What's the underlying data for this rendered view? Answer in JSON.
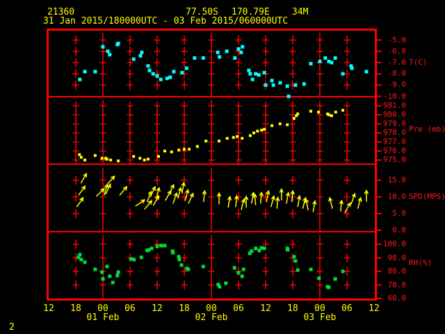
{
  "header": {
    "station_id": "21360",
    "latitude": "77.50S",
    "longitude": "170.79E",
    "elevation": "34M",
    "time_range": "31 Jan 2015/180000UTC - 03 Feb 2015/060000UTC"
  },
  "footer": {
    "page_label": "2"
  },
  "colors": {
    "background": "#000000",
    "grid": "#ff0000",
    "axis_text": "#ff1a1a",
    "header_text": "#ffff00",
    "temperature": "#00ffff",
    "pressure": "#ffff00",
    "wind": "#ffff00",
    "humidity": "#00dd3c"
  },
  "x_axis": {
    "hour_labels": [
      "12",
      "18",
      "00",
      "06",
      "12",
      "18",
      "00",
      "06",
      "12",
      "18",
      "00",
      "06",
      "12"
    ],
    "tick_interval_hours": 6,
    "hours_span": 72,
    "midnight_hours": [
      12,
      36,
      60
    ],
    "date_labels": [
      {
        "label": "01 Feb",
        "hour": 12
      },
      {
        "label": "02 Feb",
        "hour": 36
      },
      {
        "label": "03 Feb",
        "hour": 60
      }
    ]
  },
  "chart_data": [
    {
      "type": "scatter",
      "name": "temperature",
      "ylabel": "T(C)",
      "ylabel_at_value": -7,
      "yticks": [
        -5,
        -6,
        -7,
        -8,
        -9,
        -10
      ],
      "ytick_labels": [
        "-5.0",
        "-6.0",
        "-7.0",
        "-8.0",
        "-9.0",
        "-10.0"
      ],
      "x_unit": "hours since first axis tick (12UTC 31 Jan 2015)",
      "points": [
        [
          6.9,
          -8.5
        ],
        [
          8.0,
          -7.8
        ],
        [
          10.3,
          -7.8
        ],
        [
          12.0,
          -5.6
        ],
        [
          13.1,
          -6.0
        ],
        [
          13.5,
          -6.3
        ],
        [
          15.2,
          -5.4
        ],
        [
          15.4,
          -5.3
        ],
        [
          18.8,
          -6.7
        ],
        [
          20.3,
          -6.4
        ],
        [
          20.6,
          -6.1
        ],
        [
          22.0,
          -7.3
        ],
        [
          22.3,
          -7.7
        ],
        [
          23.1,
          -8.0
        ],
        [
          24.0,
          -8.2
        ],
        [
          24.8,
          -8.5
        ],
        [
          26.2,
          -8.4
        ],
        [
          26.9,
          -8.3
        ],
        [
          27.7,
          -7.8
        ],
        [
          29.5,
          -7.9
        ],
        [
          30.5,
          -7.5
        ],
        [
          32.3,
          -6.6
        ],
        [
          34.2,
          -6.6
        ],
        [
          37.4,
          -6.1
        ],
        [
          37.8,
          -6.5
        ],
        [
          39.4,
          -6.0
        ],
        [
          41.2,
          -6.6
        ],
        [
          42.0,
          -5.8
        ],
        [
          42.6,
          -6.1
        ],
        [
          42.9,
          -5.6
        ],
        [
          44.3,
          -7.7
        ],
        [
          44.6,
          -8.0
        ],
        [
          45.1,
          -8.5
        ],
        [
          45.8,
          -8.0
        ],
        [
          46.5,
          -8.1
        ],
        [
          47.7,
          -7.9
        ],
        [
          48.0,
          -9.0
        ],
        [
          49.4,
          -8.6
        ],
        [
          49.7,
          -9.0
        ],
        [
          51.2,
          -8.8
        ],
        [
          52.8,
          -9.1
        ],
        [
          53.1,
          -10.0
        ],
        [
          54.6,
          -9.0
        ],
        [
          56.5,
          -8.9
        ],
        [
          58.0,
          -7.1
        ],
        [
          60.0,
          -6.9
        ],
        [
          61.2,
          -6.6
        ],
        [
          62.0,
          -6.9
        ],
        [
          62.6,
          -7.0
        ],
        [
          63.4,
          -6.6
        ],
        [
          65.1,
          -8.0
        ],
        [
          66.9,
          -7.3
        ],
        [
          67.1,
          -7.5
        ],
        [
          70.3,
          -7.8
        ]
      ]
    },
    {
      "type": "scatter",
      "name": "pressure",
      "ylabel": "Pre (mb)",
      "ylabel_at_value": 978.4,
      "yticks": [
        981,
        980,
        979,
        978,
        977,
        976,
        975
      ],
      "ytick_labels": [
        "981.0",
        "980.0",
        "979.0",
        "978.0",
        "977.0",
        "976.0",
        "975.0"
      ],
      "x_unit": "hours since first axis tick (12UTC 31 Jan 2015)",
      "points": [
        [
          6.8,
          975.6
        ],
        [
          7.2,
          975.3
        ],
        [
          8.0,
          975.0
        ],
        [
          10.3,
          975.5
        ],
        [
          11.8,
          975.2
        ],
        [
          12.6,
          975.2
        ],
        [
          12.9,
          975.1
        ],
        [
          13.7,
          975.0
        ],
        [
          15.4,
          974.9
        ],
        [
          18.8,
          975.4
        ],
        [
          20.2,
          975.2
        ],
        [
          21.2,
          975.0
        ],
        [
          22.0,
          975.1
        ],
        [
          24.3,
          975.4
        ],
        [
          25.7,
          976.0
        ],
        [
          27.2,
          975.9
        ],
        [
          28.8,
          976.1
        ],
        [
          30.0,
          976.2
        ],
        [
          31.1,
          976.2
        ],
        [
          32.9,
          976.5
        ],
        [
          34.8,
          977.1
        ],
        [
          37.7,
          977.1
        ],
        [
          39.5,
          977.4
        ],
        [
          40.9,
          977.5
        ],
        [
          41.7,
          977.6
        ],
        [
          42.8,
          977.4
        ],
        [
          44.6,
          977.7
        ],
        [
          45.4,
          978.0
        ],
        [
          46.2,
          978.2
        ],
        [
          47.1,
          978.3
        ],
        [
          47.7,
          978.4
        ],
        [
          49.4,
          978.8
        ],
        [
          51.2,
          979.0
        ],
        [
          52.8,
          978.9
        ],
        [
          54.3,
          979.6
        ],
        [
          54.8,
          979.9
        ],
        [
          55.1,
          980.1
        ],
        [
          58.0,
          980.4
        ],
        [
          59.7,
          980.3
        ],
        [
          61.7,
          980.1
        ],
        [
          62.0,
          980.0
        ],
        [
          62.6,
          979.9
        ],
        [
          63.5,
          980.3
        ],
        [
          65.1,
          980.5
        ]
      ]
    },
    {
      "type": "wind_vectors",
      "name": "wind",
      "ylabel": "SPD(MPS)",
      "ylabel_at_value": 10,
      "yticks": [
        15,
        10,
        5,
        0
      ],
      "ytick_labels": [
        "15.0",
        "10.0",
        "5.0",
        "0.0"
      ],
      "x_unit": "hours since first axis tick (12UTC 31 Jan 2015)",
      "arrow_convention": "tail at speed value, direction degrees clockwise from up",
      "arrows": [
        [
          6.2,
          7.0,
          35
        ],
        [
          6.6,
          10.5,
          36
        ],
        [
          7.1,
          14.1,
          31
        ],
        [
          10.5,
          10.1,
          45
        ],
        [
          12.3,
          10.5,
          15
        ],
        [
          12.6,
          10.8,
          25
        ],
        [
          12.9,
          13.7,
          42
        ],
        [
          15.7,
          10.5,
          40
        ],
        [
          19.2,
          7.2,
          55
        ],
        [
          21.2,
          6.3,
          40
        ],
        [
          21.8,
          8.5,
          20
        ],
        [
          22.5,
          10.0,
          25
        ],
        [
          23.1,
          7.4,
          30
        ],
        [
          23.8,
          9.5,
          15
        ],
        [
          25.8,
          8.9,
          30
        ],
        [
          26.6,
          10.6,
          25
        ],
        [
          27.5,
          8.0,
          20
        ],
        [
          28.6,
          9.5,
          15
        ],
        [
          29.5,
          11.0,
          10
        ],
        [
          30.2,
          8.9,
          15
        ],
        [
          30.9,
          8.0,
          25
        ],
        [
          34.3,
          8.5,
          5
        ],
        [
          37.7,
          7.8,
          0
        ],
        [
          39.7,
          6.8,
          10
        ],
        [
          41.4,
          7.0,
          5
        ],
        [
          42.6,
          6.1,
          15
        ],
        [
          43.7,
          6.8,
          0
        ],
        [
          44.9,
          8.0,
          10
        ],
        [
          45.8,
          7.5,
          -5
        ],
        [
          46.9,
          8.0,
          5
        ],
        [
          48.2,
          8.5,
          10
        ],
        [
          49.2,
          7.0,
          15
        ],
        [
          50.5,
          6.5,
          5
        ],
        [
          51.5,
          9.0,
          0
        ],
        [
          52.6,
          8.0,
          10
        ],
        [
          53.8,
          8.5,
          5
        ],
        [
          55.1,
          7.0,
          10
        ],
        [
          56.2,
          6.5,
          15
        ],
        [
          57.4,
          6.0,
          -10
        ],
        [
          58.5,
          5.5,
          10
        ],
        [
          62.8,
          6.5,
          -15
        ],
        [
          64.6,
          5.6,
          5
        ],
        [
          65.5,
          5.3,
          30
        ],
        [
          66.9,
          7.8,
          20
        ],
        [
          68.4,
          6.5,
          15
        ],
        [
          70.3,
          8.6,
          0
        ]
      ]
    },
    {
      "type": "scatter",
      "name": "humidity",
      "ylabel": "RH(%)",
      "ylabel_at_value": 86,
      "yticks": [
        100,
        90,
        80,
        70,
        60
      ],
      "ytick_labels": [
        "100.0",
        "90.0",
        "80.0",
        "70.0",
        "60.0"
      ],
      "x_unit": "hours since first axis tick (12UTC 31 Jan 2015)",
      "points": [
        [
          6.6,
          90.3
        ],
        [
          6.9,
          92.3
        ],
        [
          7.2,
          88.7
        ],
        [
          8.0,
          86.7
        ],
        [
          10.3,
          81.5
        ],
        [
          11.8,
          79.5
        ],
        [
          12.0,
          74.4
        ],
        [
          12.9,
          83.6
        ],
        [
          13.5,
          76.4
        ],
        [
          14.2,
          71.8
        ],
        [
          15.2,
          76.9
        ],
        [
          15.4,
          79.5
        ],
        [
          18.2,
          89.2
        ],
        [
          18.9,
          88.7
        ],
        [
          20.5,
          90.3
        ],
        [
          21.8,
          95.4
        ],
        [
          22.2,
          95.9
        ],
        [
          22.8,
          96.9
        ],
        [
          24.0,
          98.5
        ],
        [
          24.9,
          99.0
        ],
        [
          25.7,
          99.0
        ],
        [
          27.4,
          94.9
        ],
        [
          27.5,
          93.8
        ],
        [
          28.8,
          90.8
        ],
        [
          28.9,
          88.7
        ],
        [
          29.4,
          84.6
        ],
        [
          30.6,
          82.1
        ],
        [
          30.9,
          81.5
        ],
        [
          34.2,
          83.6
        ],
        [
          37.5,
          70.3
        ],
        [
          37.8,
          68.7
        ],
        [
          39.2,
          71.3
        ],
        [
          41.1,
          82.6
        ],
        [
          42.0,
          79.0
        ],
        [
          42.8,
          76.4
        ],
        [
          43.1,
          81.5
        ],
        [
          44.5,
          93.3
        ],
        [
          44.9,
          94.9
        ],
        [
          45.8,
          96.9
        ],
        [
          46.6,
          95.4
        ],
        [
          47.1,
          97.4
        ],
        [
          47.7,
          96.9
        ],
        [
          52.8,
          96.9
        ],
        [
          52.9,
          95.9
        ],
        [
          54.3,
          90.8
        ],
        [
          54.6,
          87.7
        ],
        [
          55.1,
          81.0
        ],
        [
          58.0,
          81.5
        ],
        [
          59.8,
          74.9
        ],
        [
          61.7,
          68.7
        ],
        [
          62.0,
          68.2
        ],
        [
          63.4,
          74.4
        ],
        [
          65.1,
          80.0
        ]
      ]
    }
  ]
}
